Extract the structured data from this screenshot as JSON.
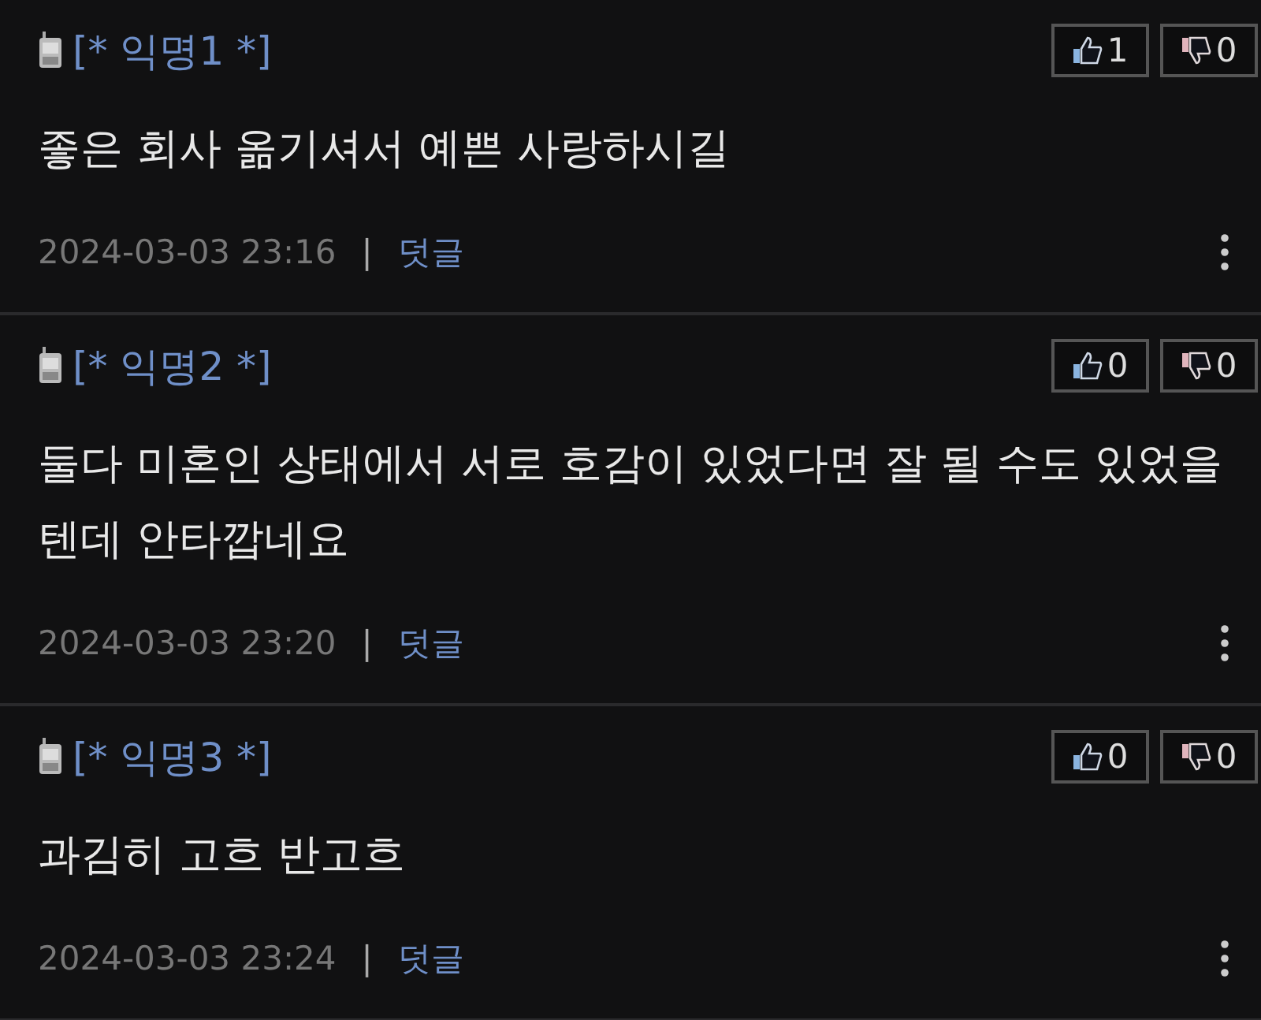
{
  "comments": [
    {
      "author": "[* 익명1 *]",
      "text": "좋은 회사 옮기셔서 예쁜 사랑하시길",
      "likes": "1",
      "dislikes": "0",
      "time": "2024-03-03 23:16",
      "separator": "|",
      "reply": "덧글"
    },
    {
      "author": "[* 익명2 *]",
      "text": "둘다 미혼인 상태에서 서로 호감이 있었다면 잘 될 수도 있었을 텐데 안타깝네요",
      "likes": "0",
      "dislikes": "0",
      "time": "2024-03-03 23:20",
      "separator": "|",
      "reply": "덧글"
    },
    {
      "author": "[* 익명3 *]",
      "text": "과김히 고흐 반고흐",
      "likes": "0",
      "dislikes": "0",
      "time": "2024-03-03 23:24",
      "separator": "|",
      "reply": "덧글"
    }
  ]
}
